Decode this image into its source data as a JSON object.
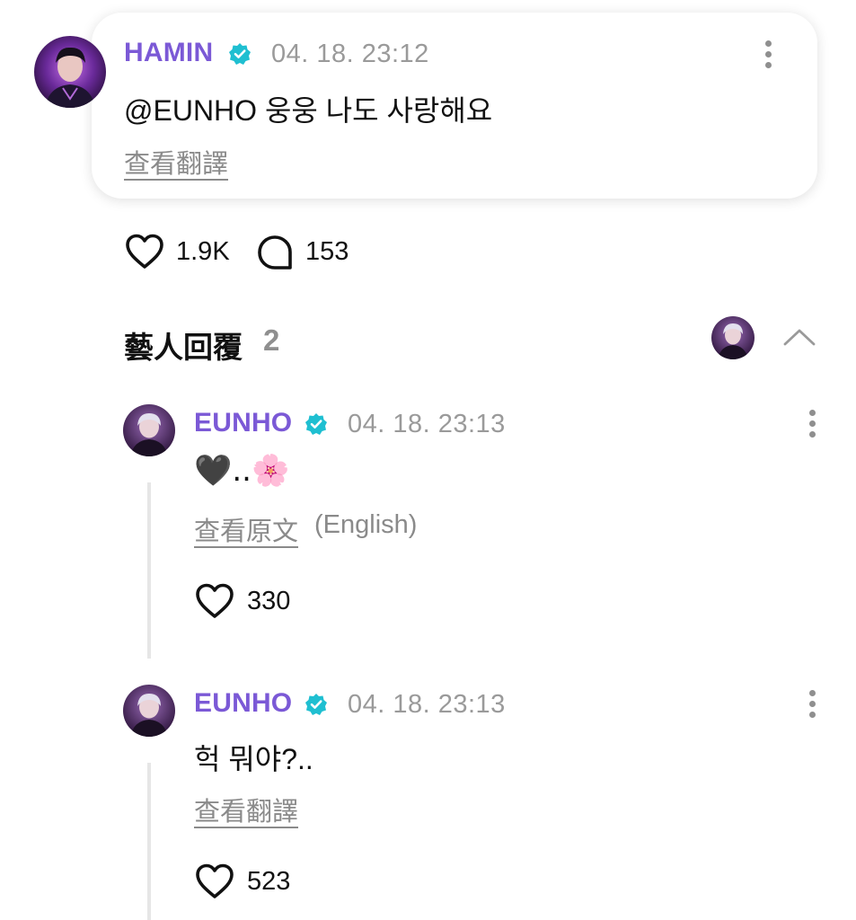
{
  "post": {
    "author": "HAMIN",
    "timestamp": "04. 18. 23:12",
    "text": "@EUNHO 웅웅 나도 사랑해요",
    "translate_label": "查看翻譯",
    "likes": "1.9K",
    "comments": "153"
  },
  "artist_replies": {
    "title": "藝人回覆",
    "count": "2"
  },
  "replies": [
    {
      "author": "EUNHO",
      "timestamp": "04. 18. 23:13",
      "text": "🖤..🌸",
      "translate_label": "查看原文",
      "language_note": "(English)",
      "likes": "330"
    },
    {
      "author": "EUNHO",
      "timestamp": "04. 18. 23:13",
      "text": "헉 뭐야?..",
      "translate_label": "查看翻譯",
      "likes": "523"
    }
  ],
  "colors": {
    "author_name": "#7b59d6",
    "verified_badge": "#1fbfd1",
    "timestamp": "#9a9a9a",
    "link_gray": "#8a8a8a"
  },
  "icons": [
    "verified-badge-icon",
    "more-vertical-icon",
    "heart-icon",
    "comment-bubble-icon",
    "chevron-up-icon"
  ]
}
